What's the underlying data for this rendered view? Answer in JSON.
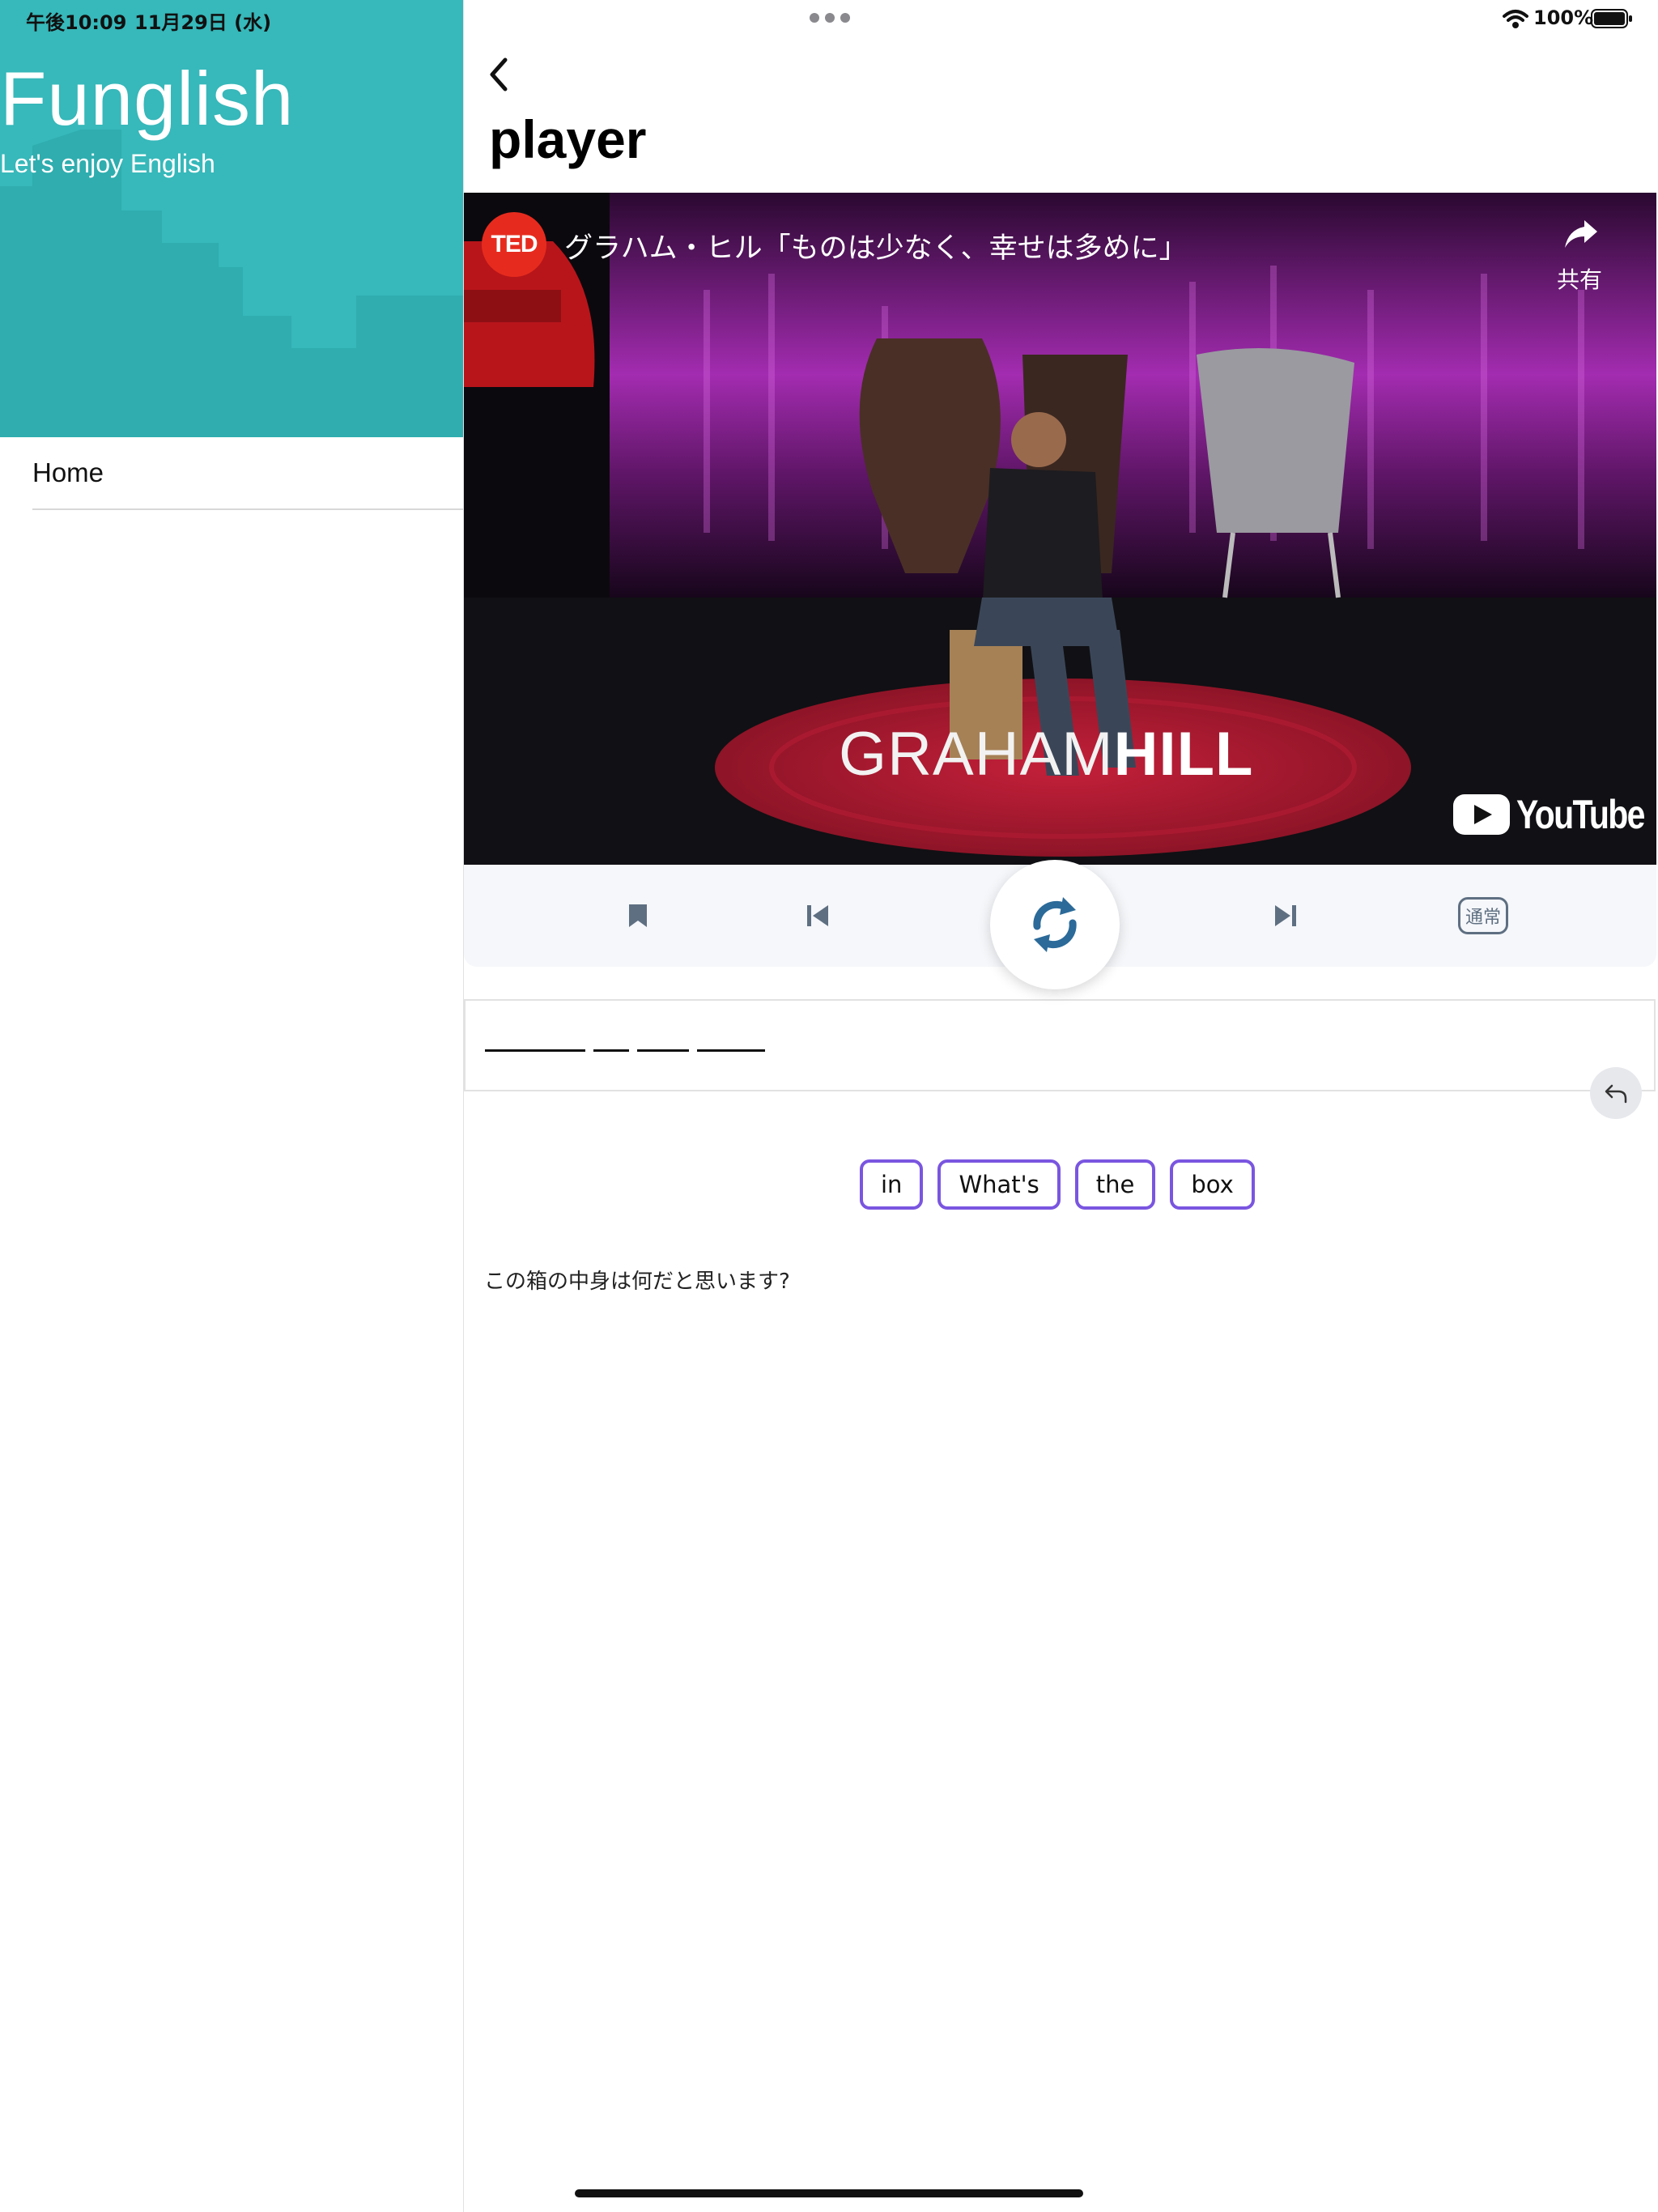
{
  "status_bar": {
    "time": "午後10:09",
    "date": "11月29日 (水)",
    "battery": "100%"
  },
  "sidebar": {
    "brand_title": "Funglish",
    "brand_subtitle": "Let's enjoy English",
    "items": [
      {
        "label": "Home"
      }
    ],
    "header_color": "#37b8ba"
  },
  "main": {
    "title": "player",
    "video": {
      "channel_badge": "TED",
      "title": "グラハム・ヒル「ものは少なく、幸せは多めに」",
      "share_label": "共有",
      "speaker_first": "GRAHAM",
      "speaker_last": "HILL",
      "provider": "YouTube"
    },
    "controls": {
      "speed_label": "通常",
      "icon_color": "#5f6f82",
      "loop_color": "#2b6a99"
    },
    "answer": {
      "blank_lengths": [
        6,
        2,
        3,
        4
      ]
    },
    "word_chips": [
      "in",
      "What's",
      "the",
      "box"
    ],
    "translation": "この箱の中身は何だと思います?"
  }
}
